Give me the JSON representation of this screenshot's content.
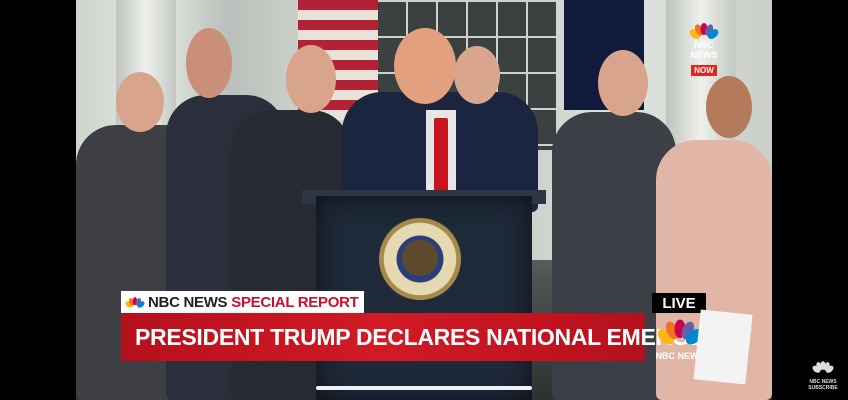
{
  "video": {
    "corner_logo": {
      "brand": "NBC NEWS",
      "tag": "NOW"
    },
    "banner": {
      "brand": "NBC NEWS",
      "label": "SPECIAL REPORT"
    },
    "headline": "PRESIDENT TRUMP DECLARES NATIONAL EMERGENCY",
    "live_label": "LIVE",
    "live_logo_text": "NBC NEWS",
    "watermark": {
      "line1": "NBC NEWS",
      "line2": "SUBSCRIBE"
    }
  },
  "colors": {
    "headline_bg": "#d21a24",
    "special_report_text": "#c8102e",
    "now_badge": "#e3251d"
  }
}
